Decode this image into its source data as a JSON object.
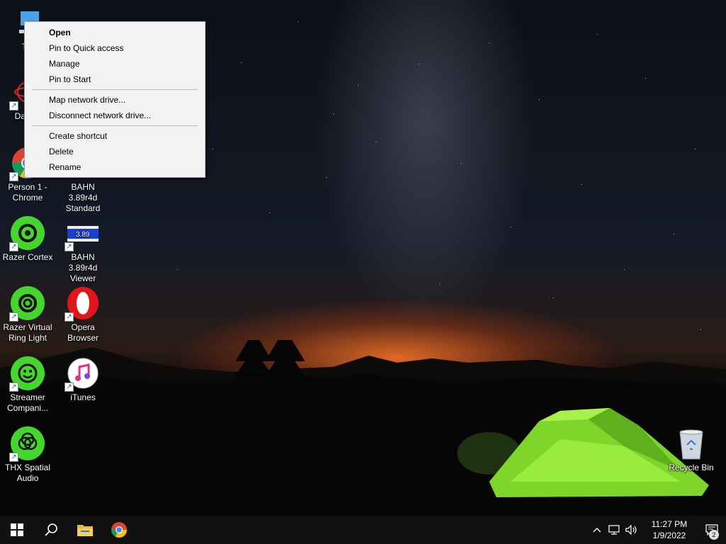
{
  "desktop": {
    "icons": [
      {
        "label": "This PC",
        "short": "Thi"
      },
      {
        "label": "DataW",
        "short": "DataW"
      },
      {
        "label": "Person 1 - Chrome"
      },
      {
        "label": "Razer Cortex"
      },
      {
        "label": "Razer Virtual Ring Light"
      },
      {
        "label": "Streamer Compani..."
      },
      {
        "label": "THX Spatial Audio"
      },
      {
        "label": "BAHN 3.89r4d Standard"
      },
      {
        "label": "BAHN 3.89r4d Viewer",
        "thumb_text": "3.89"
      },
      {
        "label": "Opera Browser"
      },
      {
        "label": "iTunes"
      },
      {
        "label": "Recycle Bin"
      }
    ]
  },
  "context_menu": {
    "items": [
      {
        "label": "Open"
      },
      {
        "label": "Pin to Quick access"
      },
      {
        "label": "Manage"
      },
      {
        "label": "Pin to Start"
      },
      {
        "label": "Map network drive..."
      },
      {
        "label": "Disconnect network drive..."
      },
      {
        "label": "Create shortcut"
      },
      {
        "label": "Delete"
      },
      {
        "label": "Rename"
      }
    ]
  },
  "taskbar": {
    "start_icon": "windows-logo-icon",
    "search_icon": "search-icon",
    "pinned": [
      "file-explorer-icon",
      "chrome-icon"
    ],
    "tray_icons": [
      "chevron-up-icon",
      "network-icon",
      "volume-icon"
    ],
    "time": "11:27 PM",
    "date": "1/9/2022",
    "notification_count": "2"
  },
  "colors": {
    "razer_green": "#44d62c",
    "taskbar": "#101010",
    "menu_bg": "#f2f2f2"
  }
}
